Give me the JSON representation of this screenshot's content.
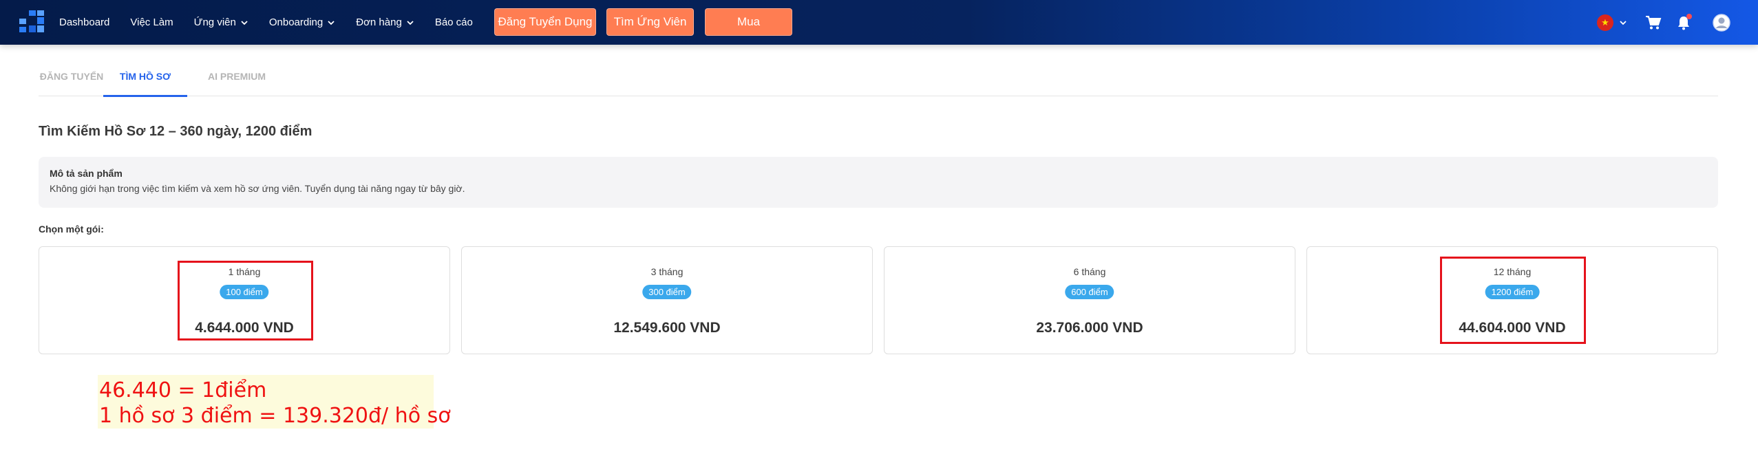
{
  "nav": {
    "items": [
      {
        "label": "Dashboard",
        "has_dropdown": false
      },
      {
        "label": "Việc Làm",
        "has_dropdown": false
      },
      {
        "label": "Ứng viên",
        "has_dropdown": true
      },
      {
        "label": "Onboarding",
        "has_dropdown": true
      },
      {
        "label": "Đơn hàng",
        "has_dropdown": true
      },
      {
        "label": "Báo cáo",
        "has_dropdown": false
      }
    ],
    "buttons": {
      "post_job": "Đăng Tuyển Dụng",
      "find_candidate": "Tìm Ứng Viên",
      "buy": "Mua"
    },
    "icons": [
      "logo-icon",
      "vietnam-flag-icon",
      "chevron-down-icon",
      "cart-icon",
      "bell-icon",
      "user-avatar-icon"
    ]
  },
  "tabs": [
    {
      "label": "ĐĂNG TUYỂN",
      "active": false
    },
    {
      "label": "TÌM HỒ SƠ",
      "active": true
    },
    {
      "label": "AI PREMIUM",
      "active": false
    }
  ],
  "product": {
    "title": "Tìm Kiếm Hồ Sơ 12 – 360 ngày, 1200 điểm",
    "description_title": "Mô tả sản phẩm",
    "description_text": "Không giới hạn trong việc tìm kiếm và xem hồ sơ ứng viên. Tuyển dụng tài năng ngay từ bây giờ.",
    "choose_label": "Chọn một gói:"
  },
  "packages": [
    {
      "duration": "1 tháng",
      "points": "100 điểm",
      "price": "4.644.000 VND",
      "highlighted": true
    },
    {
      "duration": "3 tháng",
      "points": "300 điểm",
      "price": "12.549.600 VND",
      "highlighted": false
    },
    {
      "duration": "6 tháng",
      "points": "600 điểm",
      "price": "23.706.000 VND",
      "highlighted": false
    },
    {
      "duration": "12 tháng",
      "points": "1200 điểm",
      "price": "44.604.000 VND",
      "highlighted": true
    }
  ],
  "annotation": {
    "line1": "46.440 = 1điểm",
    "line2": "1 hồ sơ 3 điểm = 139.320đ/ hồ sơ"
  },
  "colors": {
    "nav_gradient_start": "#041b4a",
    "nav_gradient_end": "#1458e6",
    "orange_button": "#ff7d52",
    "active_tab": "#2563eb",
    "points_badge": "#3aa8ec",
    "highlight_box": "#e5121b",
    "note_text": "#ef1212",
    "note_background": "#fdfbdc"
  }
}
